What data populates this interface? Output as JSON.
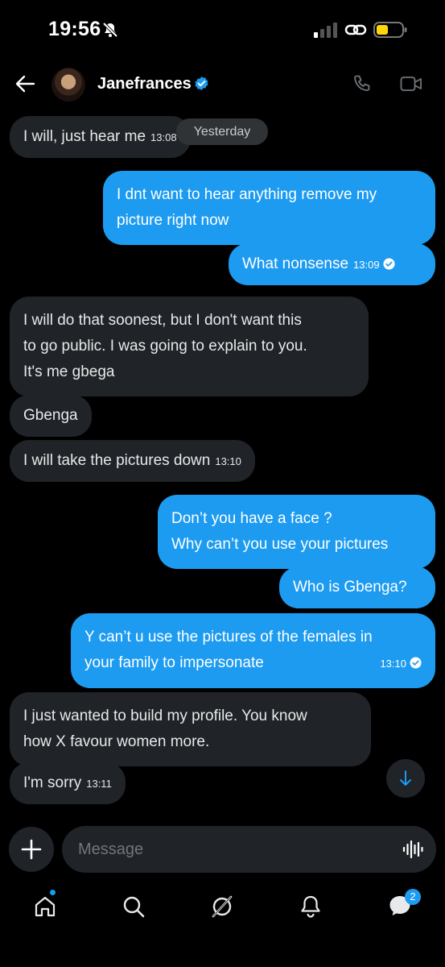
{
  "status_bar": {
    "time": "19:56"
  },
  "header": {
    "contact_name": "Janefrances"
  },
  "divider": {
    "label": "Yesterday"
  },
  "messages": [
    {
      "direction": "in",
      "lines": [
        "I will, just hear me"
      ],
      "time": "13:08"
    },
    {
      "direction": "out",
      "lines": [
        "I dnt want to hear anything remove my",
        "picture right now"
      ],
      "time": ""
    },
    {
      "direction": "out",
      "lines": [
        "What nonsense"
      ],
      "time": "13:09"
    },
    {
      "direction": "in",
      "lines": [
        "I will do that soonest, but I don't want this",
        "to go public. I was going to explain to you.",
        "It's me gbega"
      ],
      "time": ""
    },
    {
      "direction": "in",
      "lines": [
        "Gbenga"
      ],
      "time": ""
    },
    {
      "direction": "in",
      "lines": [
        "I will take the pictures down"
      ],
      "time": "13:10"
    },
    {
      "direction": "out",
      "lines": [
        "Don’t you have a face ?",
        "Why can’t you use your pictures"
      ],
      "time": ""
    },
    {
      "direction": "out",
      "lines": [
        "Who is Gbenga?"
      ],
      "time": ""
    },
    {
      "direction": "out",
      "lines": [
        "Y can’t u use the pictures of the females in",
        "your family to impersonate"
      ],
      "time": "13:10"
    },
    {
      "direction": "in",
      "lines": [
        "I just wanted to build my profile. You know",
        "how X favour women more."
      ],
      "time": ""
    },
    {
      "direction": "in",
      "lines": [
        "I'm sorry"
      ],
      "time": "13:11"
    }
  ],
  "composer": {
    "placeholder": "Message"
  },
  "bottom_nav": {
    "messages_badge": "2"
  },
  "colors": {
    "accent": "#1d9bf0",
    "incoming_bubble": "#202327",
    "background": "#000000"
  },
  "icons": [
    "bell-off-icon",
    "signal-icon",
    "link-icon",
    "battery-icon",
    "back-arrow-icon",
    "verified-icon",
    "phone-icon",
    "video-icon",
    "arrow-down-icon",
    "plus-icon",
    "voice-icon",
    "home-icon",
    "search-icon",
    "grok-icon",
    "bell-icon",
    "messages-icon"
  ]
}
